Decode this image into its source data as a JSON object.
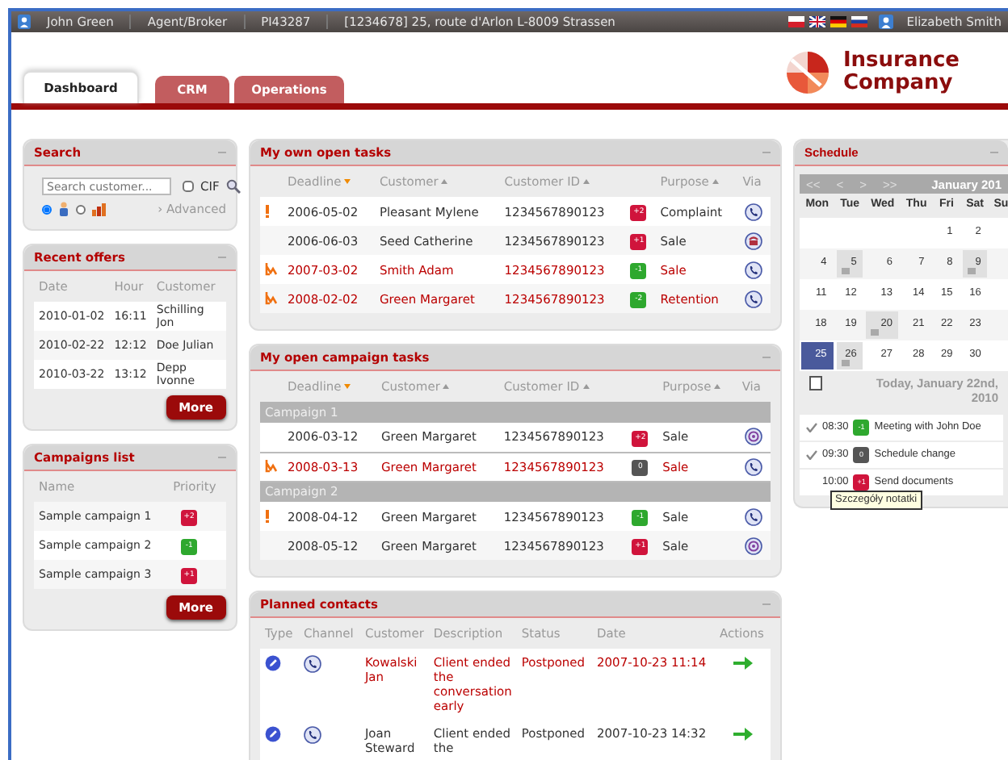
{
  "top_bar": {
    "user": "John Green",
    "role": "Agent/Broker",
    "agent_id": "PI43287",
    "address": "[1234678] 25, route d'Arlon L-8009 Strassen",
    "languages": [
      {
        "kind": "pl"
      },
      {
        "kind": "gb"
      },
      {
        "kind": "de"
      },
      {
        "kind": "ru"
      }
    ],
    "operator": "Elizabeth Smith"
  },
  "tabs": [
    {
      "label": "Dashboard",
      "selected": true
    },
    {
      "label": "CRM",
      "selected": false
    },
    {
      "label": "Operations",
      "selected": false
    }
  ],
  "logo": {
    "line_1": "Insurance",
    "line_2": "Company"
  },
  "search": {
    "title": "Search",
    "placeholder": "Search customer...",
    "cif_label": "CIF",
    "cif_checked": false,
    "modes": [
      {
        "kind": "person",
        "selected": true
      },
      {
        "kind": "company",
        "selected": false
      }
    ],
    "advanced": "› Advanced"
  },
  "recent_offers": {
    "title": "Recent offers",
    "columns": [
      "Date",
      "Hour",
      "Customer"
    ],
    "rows": [
      [
        "2010-01-02",
        "16:11",
        "Schilling Jon"
      ],
      [
        "2010-02-22",
        "12:12",
        "Doe Julian"
      ],
      [
        "2010-03-22",
        "13:12",
        "Depp Ivonne"
      ]
    ],
    "more": "More"
  },
  "campaigns": {
    "title": "Campaigns list",
    "columns": [
      "Name",
      "Priority"
    ],
    "rows": [
      {
        "name": "Sample campaign 1",
        "priority": "+2",
        "color": "#d0143c"
      },
      {
        "name": "Sample campaign 2",
        "priority": "-1",
        "color": "#2ea82e"
      },
      {
        "name": "Sample campaign 3",
        "priority": "+1",
        "color": "#d0143c"
      }
    ],
    "more": "More"
  },
  "own_tasks": {
    "title": "My own open tasks",
    "columns": [
      {
        "label": "Deadline",
        "kind": "sorted"
      },
      {
        "label": "Customer",
        "kind": "sortable"
      },
      {
        "label": "Customer ID",
        "kind": "sortable"
      },
      {
        "label": "Purpose",
        "kind": "sortable"
      },
      {
        "label": "Via",
        "kind": "plain"
      }
    ],
    "rows": [
      {
        "flag": {
          "kind": "urgent"
        },
        "overdue": false,
        "deadline": "2006-05-02",
        "customer": "Pleasant Mylene",
        "customer_id": "1234567890123",
        "priority": "+2",
        "color": "#d0143c",
        "purpose": "Complaint",
        "via": {
          "kind": "phone"
        }
      },
      {
        "overdue": false,
        "deadline": "2006-06-03",
        "customer": "Seed Catherine",
        "customer_id": "1234567890123",
        "priority": "+1",
        "color": "#d0143c",
        "purpose": "Sale",
        "via": {
          "kind": "fax"
        }
      },
      {
        "flag": {
          "kind": "escalated"
        },
        "overdue": true,
        "deadline": "2007-03-02",
        "customer": "Smith Adam",
        "customer_id": "1234567890123",
        "priority": "-1",
        "color": "#2ea82e",
        "purpose": "Sale",
        "via": {
          "kind": "phone"
        }
      },
      {
        "flag": {
          "kind": "escalated"
        },
        "overdue": true,
        "deadline": "2008-02-02",
        "customer": "Green Margaret",
        "customer_id": "1234567890123",
        "priority": "-2",
        "color": "#2ea82e",
        "purpose": "Retention",
        "via": {
          "kind": "phone"
        }
      }
    ]
  },
  "campaign_tasks": {
    "title": "My open campaign tasks",
    "columns": [
      {
        "label": "Deadline",
        "kind": "sorted"
      },
      {
        "label": "Customer",
        "kind": "sortable"
      },
      {
        "label": "Customer ID",
        "kind": "sortable"
      },
      {
        "label": "Purpose",
        "kind": "sortable"
      },
      {
        "label": "Via",
        "kind": "plain"
      }
    ],
    "groups": [
      {
        "name": "Campaign 1",
        "rows": [
          {
            "overdue": false,
            "selected": false,
            "deadline": "2006-03-12",
            "customer": "Green Margaret",
            "customer_id": "1234567890123",
            "priority": "+2",
            "color": "#d0143c",
            "purpose": "Sale",
            "via": {
              "kind": "email"
            }
          },
          {
            "flag": {
              "kind": "escalated"
            },
            "overdue": true,
            "selected": true,
            "deadline": "2008-03-13",
            "customer": "Green Margaret",
            "customer_id": "1234567890123",
            "priority": "0",
            "color": "#555555",
            "purpose": "Sale",
            "via": {
              "kind": "phone"
            }
          }
        ]
      },
      {
        "name": "Campaign 2",
        "rows": [
          {
            "flag": {
              "kind": "urgent"
            },
            "overdue": false,
            "selected": false,
            "deadline": "2008-04-12",
            "customer": "Green Margaret",
            "customer_id": "1234567890123",
            "priority": "-1",
            "color": "#2ea82e",
            "purpose": "Sale",
            "via": {
              "kind": "phone"
            }
          },
          {
            "overdue": false,
            "selected": false,
            "deadline": "2008-05-12",
            "customer": "Green Margaret",
            "customer_id": "1234567890123",
            "priority": "+1",
            "color": "#d0143c",
            "purpose": "Sale",
            "via": {
              "kind": "email"
            }
          }
        ]
      }
    ]
  },
  "planned_contacts": {
    "title": "Planned contacts",
    "columns": [
      "Type",
      "Channel",
      "Customer",
      "Description",
      "Status",
      "Date",
      "Actions"
    ],
    "rows": [
      {
        "overdue": true,
        "channel": {
          "kind": "phone"
        },
        "customer": "Kowalski Jan",
        "description": "Client ended the conversation early",
        "status": "Postponed",
        "date": "2007-10-23 11:14"
      },
      {
        "overdue": false,
        "channel": {
          "kind": "phone"
        },
        "customer": "Joan Steward",
        "description": "Client ended the",
        "status": "Postponed",
        "date": "2007-10-23 14:32"
      }
    ]
  },
  "schedule": {
    "title": "Schedule",
    "nav": [
      "<<",
      "<",
      ">",
      ">>"
    ],
    "month": "January 201",
    "weekdays": [
      "Mon",
      "Tue",
      "Wed",
      "Thu",
      "Fri",
      "Sat",
      "Su"
    ],
    "weeks": [
      [
        {
          "day": "1",
          "note": false,
          "selected": false
        },
        {
          "day": "2",
          "note": false,
          "selected": false
        }
      ],
      [
        {
          "day": "4",
          "note": false,
          "selected": false
        },
        {
          "day": "5",
          "note": true,
          "selected": false
        },
        {
          "day": "6",
          "note": false,
          "selected": false
        },
        {
          "day": "7",
          "note": false,
          "selected": false
        },
        {
          "day": "8",
          "note": false,
          "selected": false
        },
        {
          "day": "9",
          "note": true,
          "selected": false
        }
      ],
      [
        {
          "day": "11",
          "note": false,
          "selected": false
        },
        {
          "day": "12",
          "note": false,
          "selected": false
        },
        {
          "day": "13",
          "note": false,
          "selected": false
        },
        {
          "day": "14",
          "note": false,
          "selected": false
        },
        {
          "day": "15",
          "note": false,
          "selected": false
        },
        {
          "day": "16",
          "note": false,
          "selected": false
        }
      ],
      [
        {
          "day": "18",
          "note": false,
          "selected": false
        },
        {
          "day": "19",
          "note": false,
          "selected": false
        },
        {
          "day": "20",
          "note": true,
          "selected": false
        },
        {
          "day": "21",
          "note": false,
          "selected": false
        },
        {
          "day": "22",
          "note": false,
          "selected": false
        },
        {
          "day": "23",
          "note": false,
          "selected": false
        }
      ],
      [
        {
          "day": "25",
          "note": false,
          "selected": true
        },
        {
          "day": "26",
          "note": true,
          "selected": false
        },
        {
          "day": "27",
          "note": false,
          "selected": false
        },
        {
          "day": "28",
          "note": false,
          "selected": false
        },
        {
          "day": "29",
          "note": false,
          "selected": false
        },
        {
          "day": "30",
          "note": false,
          "selected": false
        }
      ]
    ],
    "today": "Today, January 22nd, 2010",
    "events": [
      {
        "done": true,
        "time": "08:30",
        "badge": "-1",
        "color": "#2ea82e",
        "title": "Meeting with John Doe"
      },
      {
        "done": true,
        "time": "09:30",
        "badge": "0",
        "color": "#555555",
        "title": "Schedule change"
      },
      {
        "done": false,
        "time": "10:00",
        "badge": "+1",
        "color": "#d0143c",
        "title": "Send documents"
      }
    ],
    "tooltip": "Szczegóły notatki"
  }
}
